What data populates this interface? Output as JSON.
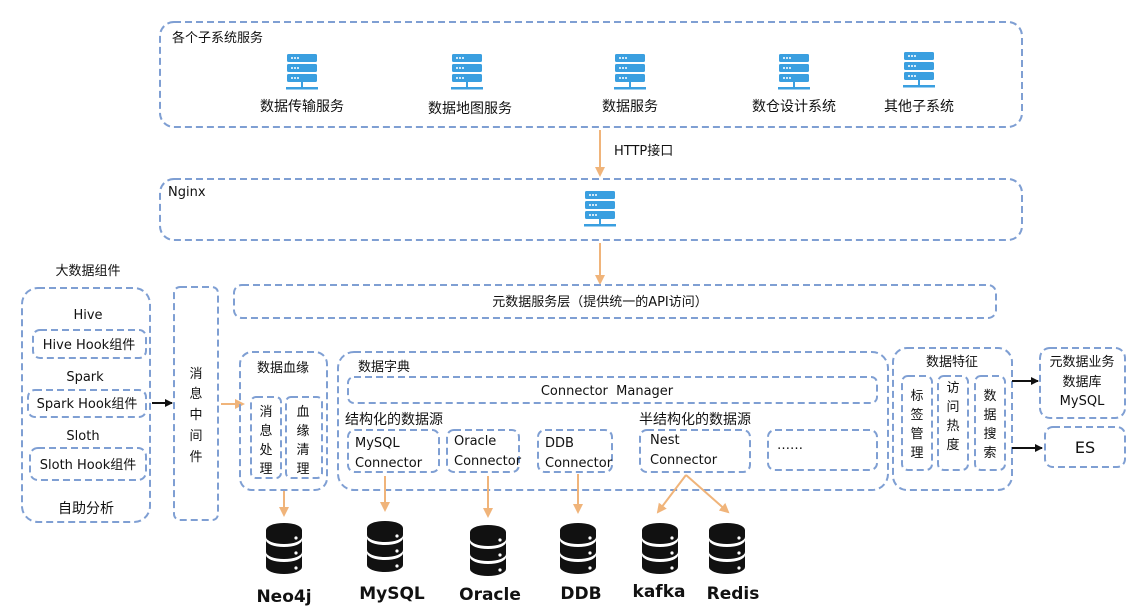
{
  "colors": {
    "border": "#7f9fd3",
    "flow_arrow": "#f0b47a",
    "server_icon": "#3a9fe0",
    "database_icon": "#111111"
  },
  "subsystems": {
    "title": "各个子系统服务",
    "items": [
      "数据传输服务",
      "数据地图服务",
      "数据服务",
      "数仓设计系统",
      "其他子系统"
    ]
  },
  "http_label": "HTTP接口",
  "nginx": {
    "title": "Nginx"
  },
  "metadata_service_layer": "元数据服务层（提供统一的API访问）",
  "bigdata": {
    "title": "大数据组件",
    "groups": [
      {
        "name": "Hive",
        "hook": "Hive Hook组件"
      },
      {
        "name": "Spark",
        "hook": "Spark Hook组件"
      },
      {
        "name": "Sloth",
        "hook": "Sloth Hook组件"
      }
    ],
    "footer": "自助分析"
  },
  "message_middleware": [
    "消",
    "息",
    "中",
    "间",
    "件"
  ],
  "lineage": {
    "title": "数据血缘",
    "sub": [
      [
        "消",
        "息",
        "处",
        "理"
      ],
      [
        "血",
        "缘",
        "清",
        "理"
      ]
    ]
  },
  "dictionary": {
    "title": "数据字典",
    "manager": "Connector  Manager",
    "structured": "结构化的数据源",
    "semi_structured": "半结构化的数据源",
    "connectors": [
      [
        "MySQL",
        "Connector"
      ],
      [
        "Oracle",
        "Connector"
      ],
      [
        "DDB",
        "Connector"
      ],
      [
        "Nest",
        "Connector"
      ],
      [
        "……",
        ""
      ]
    ]
  },
  "features": {
    "title": "数据特征",
    "sub": [
      [
        "标",
        "签",
        "管",
        "理"
      ],
      [
        "访",
        "问",
        "热",
        "度"
      ],
      [
        "数",
        "据",
        "搜",
        "索"
      ]
    ]
  },
  "business_db": [
    "元数据业务",
    "数据库",
    "MySQL"
  ],
  "es": "ES",
  "databases": [
    "Neo4j",
    "MySQL",
    "Oracle",
    "DDB",
    "kafka",
    "Redis"
  ]
}
